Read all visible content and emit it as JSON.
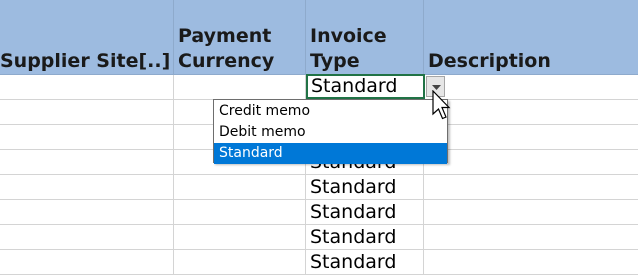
{
  "headers": {
    "supplier_site": "Supplier Site[..]",
    "payment_currency_line1": "Payment",
    "payment_currency_line2": "Currency",
    "invoice_type_line1": "Invoice",
    "invoice_type_line2": "Type",
    "description": "Description"
  },
  "active_cell": {
    "value": "Standard"
  },
  "dropdown": {
    "options": [
      "Credit memo",
      "Debit memo",
      "Standard"
    ],
    "selected": "Standard"
  },
  "rows": [
    {
      "invoice_type": "Standard"
    },
    {
      "invoice_type": "Standard"
    },
    {
      "invoice_type": "Standard"
    },
    {
      "invoice_type": "Standard"
    },
    {
      "invoice_type": "Standard"
    },
    {
      "invoice_type": "Standard"
    },
    {
      "invoice_type": "Standard"
    },
    {
      "invoice_type": "Standard"
    }
  ],
  "colors": {
    "header_bg": "#9dbbe0",
    "active_border": "#217346",
    "selection": "#0078d7"
  },
  "icons": {
    "dropdown_arrow": "chevron-down-icon",
    "cursor": "mouse-pointer-icon"
  }
}
